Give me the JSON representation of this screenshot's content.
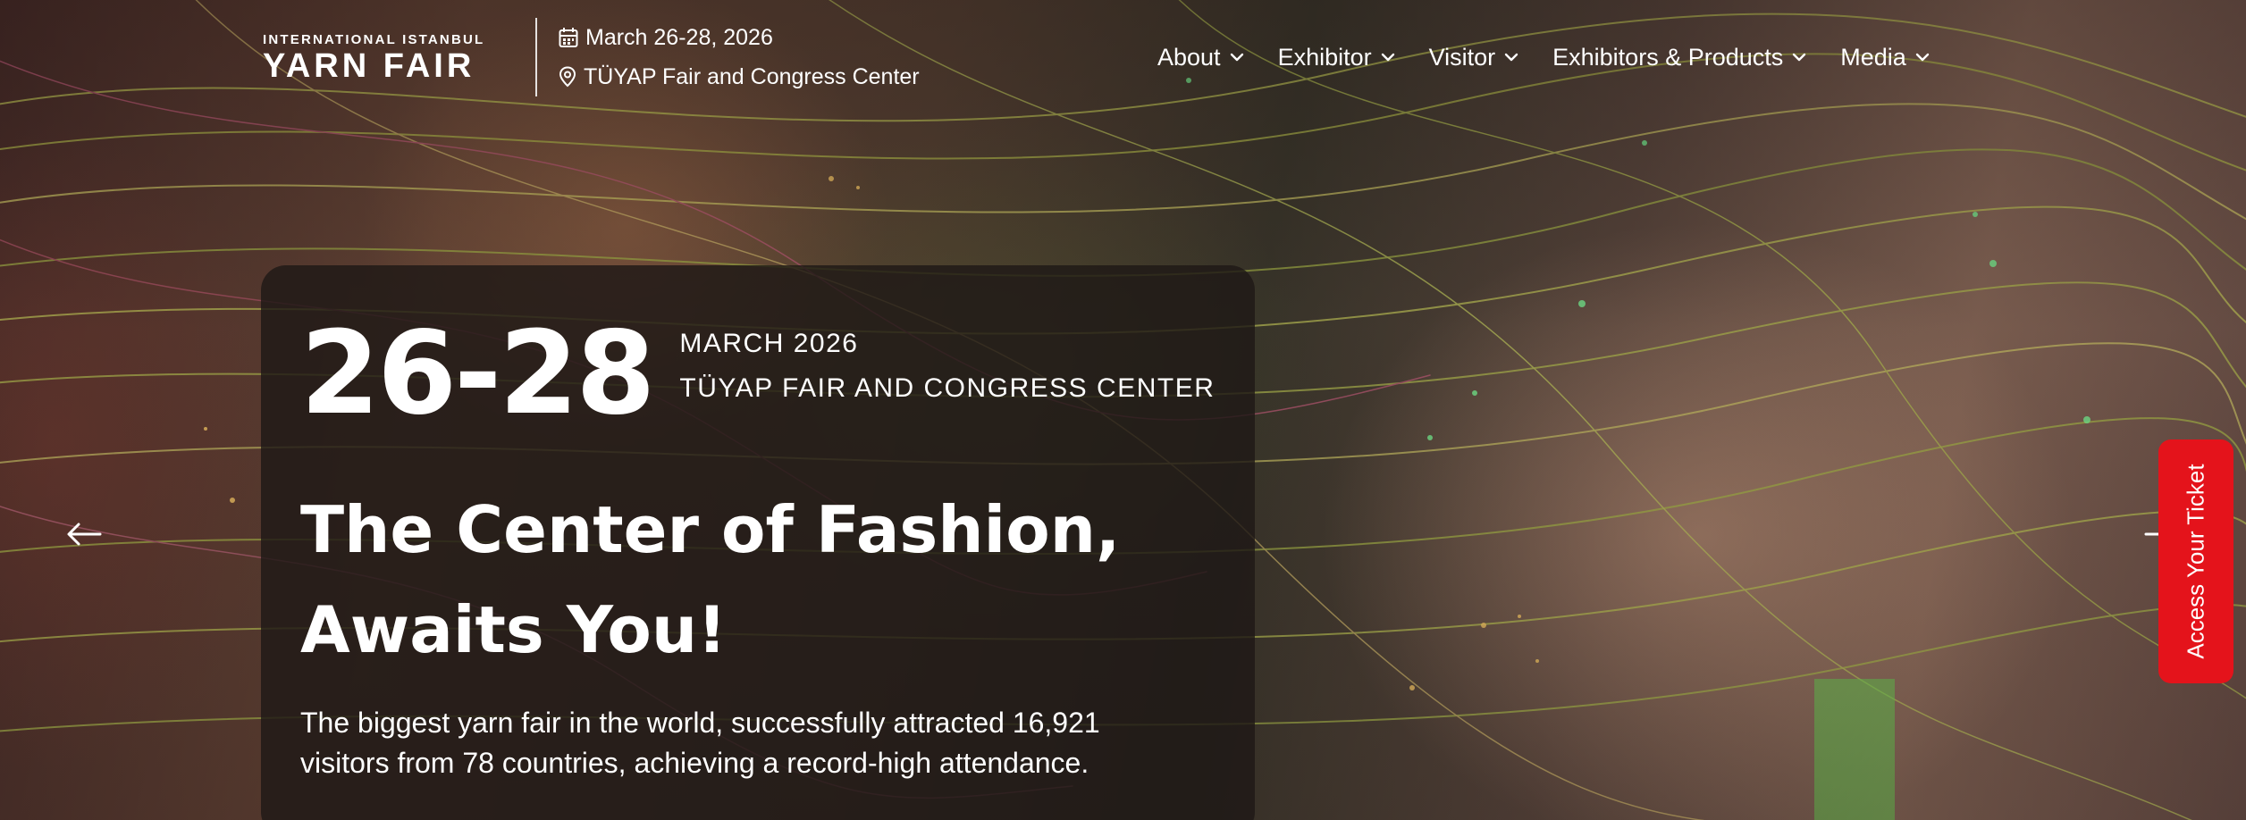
{
  "header": {
    "logo": {
      "top": "INTERNATIONAL ISTANBUL",
      "main": "YARN FAIR"
    },
    "event": {
      "date": "March 26-28, 2026",
      "location": "TÜYAP Fair and Congress Center",
      "date_icon": "calendar-icon",
      "location_icon": "map-pin-icon"
    },
    "nav": [
      {
        "label": "About"
      },
      {
        "label": "Exhibitor"
      },
      {
        "label": "Visitor"
      },
      {
        "label": "Exhibitors & Products"
      },
      {
        "label": "Media"
      }
    ]
  },
  "hero": {
    "date_range": "26-28",
    "month": "MARCH 2026",
    "venue": "TÜYAP FAIR AND CONGRESS CENTER",
    "headline_line1": "The Center of Fashion,",
    "headline_line2": "Awaits You!",
    "description_line1": "The biggest yarn fair in the world, successfully attracted 16,921",
    "description_line2": "visitors from 78 countries, achieving a record-high attendance."
  },
  "slider": {
    "prev_icon": "arrow-left-icon",
    "next_icon": "arrow-right-icon"
  },
  "ticket_tab": {
    "label": "Access Your Ticket",
    "color": "#e4131b"
  }
}
